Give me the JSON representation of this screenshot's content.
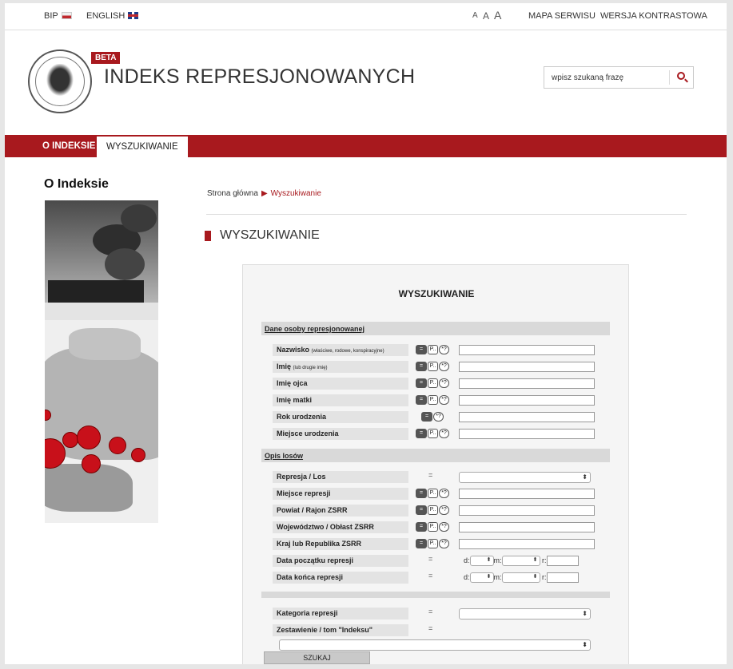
{
  "topbar": {
    "bip": "BIP",
    "english": "ENGLISH",
    "font_sizes": [
      "A",
      "A",
      "A"
    ],
    "sitemap": "MAPA SERWISU",
    "contrast": "WERSJA KONTRASTOWA"
  },
  "header": {
    "badge": "BETA",
    "title": "INDEKS REPRESJONOWANYCH",
    "logo_text": "INSTYTUT PAMIĘCI NARODOWEJ",
    "search_placeholder": "wpisz szukaną frazę"
  },
  "nav": {
    "items": [
      {
        "label": "O INDEKSIE"
      },
      {
        "label": "WYSZUKIWANIE"
      }
    ]
  },
  "sidebar": {
    "title": "O Indeksie"
  },
  "breadcrumb": {
    "home": "Strona główna",
    "arrow": "▶",
    "current": "Wyszukiwanie"
  },
  "page_title": "WYSZUKIWANIE",
  "form": {
    "title": "WYSZUKIWANIE",
    "buttons": {
      "eq": "=",
      "p": "P..",
      "q": "*?"
    },
    "section_person": "Dane osoby represjonowanej",
    "person_fields": [
      {
        "label": "Nazwisko",
        "hint": "(właściwe, rodowe, konspiracyjne)"
      },
      {
        "label": "Imię",
        "hint": "(lub drugie imię)"
      },
      {
        "label": "Imię ojca",
        "hint": ""
      },
      {
        "label": "Imię matki",
        "hint": ""
      },
      {
        "label": "Rok urodzenia",
        "hint": ""
      },
      {
        "label": "Miejsce urodzenia",
        "hint": ""
      }
    ],
    "section_fate": "Opis losów",
    "fate_fields": [
      {
        "label": "Represja / Los"
      },
      {
        "label": "Miejsce represji"
      },
      {
        "label": "Powiat / Rajon ZSRR"
      },
      {
        "label": "Województwo / Obłast ZSRR"
      },
      {
        "label": "Kraj lub Republika ZSRR"
      },
      {
        "label": "Data początku represji"
      },
      {
        "label": "Data końca represji"
      }
    ],
    "eq_sign": "=",
    "date_labels": {
      "d": "d:",
      "m": "m:",
      "r": "r:"
    },
    "category_label": "Kategoria represji",
    "volume_label": "Zestawienie / tom \"Indeksu\"",
    "select_arrow": "⬍",
    "submit": "SZUKAJ"
  },
  "colors": {
    "accent": "#a8191e"
  }
}
